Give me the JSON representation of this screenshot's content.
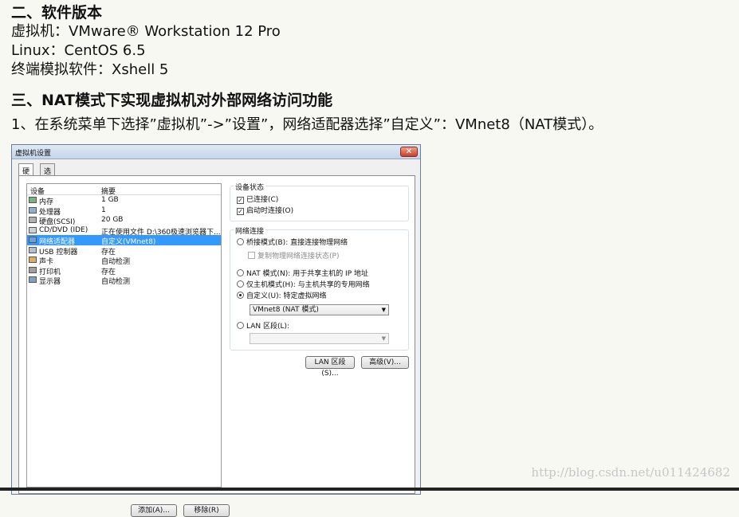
{
  "article": {
    "section2_title": "二、软件版本",
    "lines": [
      "虚拟机：VMware® Workstation 12 Pro",
      "Linux：CentOS 6.5",
      "终端模拟软件：Xshell 5"
    ],
    "section3_title": "三、NAT模式下实现虚拟机对外部网络访问功能",
    "step1": "1、在系统菜单下选择”虚拟机”->”设置”，网络适配器选择”自定义”：VMnet8（NAT模式）。",
    "watermark": "http://blog.csdn.net/u011424682"
  },
  "dialog": {
    "title": "虚拟机设置",
    "close_glyph": "✕",
    "tabs": [
      "硬件",
      "选项"
    ],
    "device_list": {
      "col_device": "设备",
      "col_summary": "摘要",
      "rows": [
        {
          "icon": "memory-icon",
          "name": "内存",
          "summary": "1 GB",
          "selected": false
        },
        {
          "icon": "cpu-icon",
          "name": "处理器",
          "summary": "1",
          "selected": false
        },
        {
          "icon": "hard-disk-icon",
          "name": "硬盘(SCSI)",
          "summary": "20 GB",
          "selected": false
        },
        {
          "icon": "cd-dvd-icon",
          "name": "CD/DVD (IDE)",
          "summary": "正在使用文件 D:\\360极速浏览器下...",
          "selected": false
        },
        {
          "icon": "network-adapter-icon",
          "name": "网络适配器",
          "summary": "自定义(VMnet8)",
          "selected": true
        },
        {
          "icon": "usb-icon",
          "name": "USB 控制器",
          "summary": "存在",
          "selected": false
        },
        {
          "icon": "sound-card-icon",
          "name": "声卡",
          "summary": "自动检测",
          "selected": false
        },
        {
          "icon": "printer-icon",
          "name": "打印机",
          "summary": "存在",
          "selected": false
        },
        {
          "icon": "display-icon",
          "name": "显示器",
          "summary": "自动检测",
          "selected": false
        }
      ],
      "add_button": "添加(A)...",
      "remove_button": "移除(R)"
    },
    "device_status": {
      "legend": "设备状态",
      "connected": "已连接(C)",
      "connect_at_power_on": "启动时连接(O)",
      "connected_checked": true,
      "connect_at_power_on_checked": true
    },
    "network_connection": {
      "legend": "网络连接",
      "bridged": "桥接模式(B): 直接连接物理网络",
      "replicate": "复制物理网络连接状态(P)",
      "nat": "NAT 模式(N): 用于共享主机的 IP 地址",
      "host_only": "仅主机模式(H): 与主机共享的专用网络",
      "custom": "自定义(U): 特定虚拟网络",
      "custom_selected": true,
      "custom_value": "VMnet8 (NAT 模式)",
      "lan_segment": "LAN 区段(L):",
      "lan_value": ""
    },
    "lan_segments_button": "LAN 区段(S)...",
    "advanced_button": "高级(V)..."
  },
  "colors": {
    "selection": "#3399ff",
    "page_background": "#f8f8f3"
  }
}
